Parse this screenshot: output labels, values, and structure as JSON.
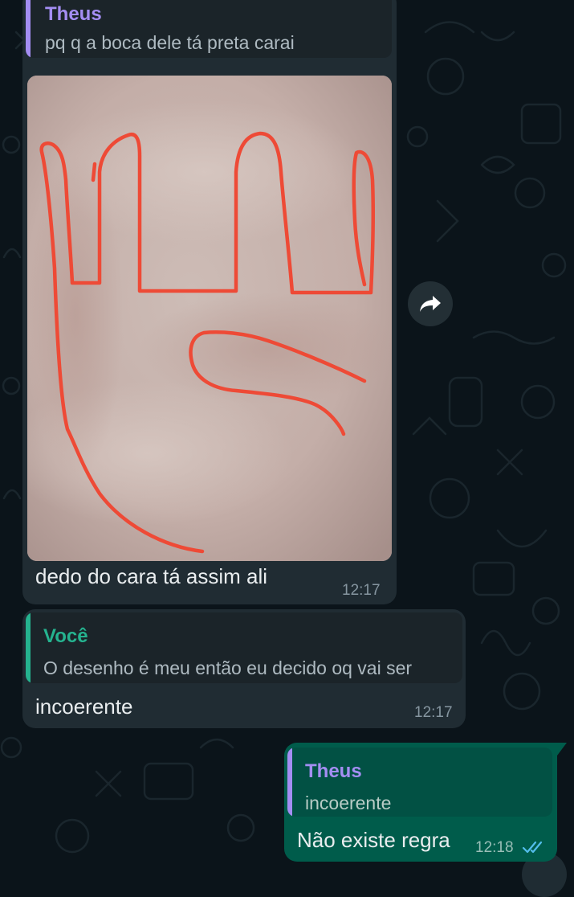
{
  "colors": {
    "background": "#0b141a",
    "incoming_bubble": "#202c33",
    "outgoing_bubble": "#005c4b",
    "name_theus": "#a48ef3",
    "name_voce": "#25b38f",
    "brush_stroke": "#ee4a36",
    "read_ticks": "#53bdeb"
  },
  "messages": [
    {
      "direction": "incoming",
      "quoted": {
        "author": "Theus",
        "text": "pq q a boca dele tá preta carai"
      },
      "image": {
        "description_icon": "photo-with-red-drawing"
      },
      "text": "dedo do cara tá assim ali",
      "time": "12:17"
    },
    {
      "direction": "incoming",
      "quoted": {
        "author": "Você",
        "text": "O desenho é meu então eu decido oq vai ser"
      },
      "text": "incoerente",
      "time": "12:17"
    },
    {
      "direction": "outgoing",
      "quoted": {
        "author": "Theus",
        "text": "incoerente"
      },
      "text": "Não existe regra",
      "time": "12:18",
      "status_icon": "double-check-read-icon"
    }
  ],
  "actions": {
    "forward_icon": "forward-arrow-icon",
    "scroll_icon": "scroll-down-icon"
  }
}
